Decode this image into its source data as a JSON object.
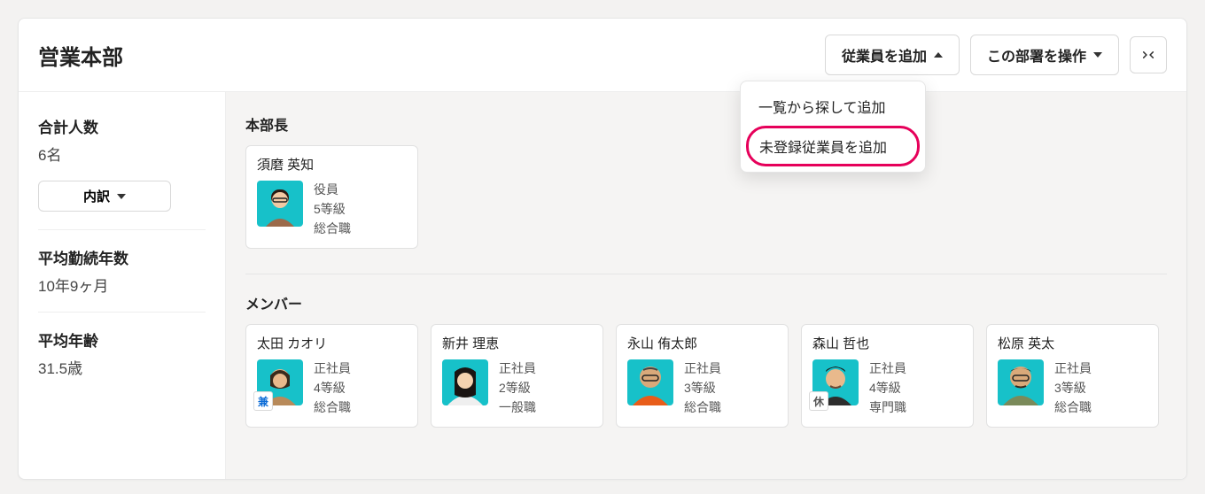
{
  "header": {
    "title": "営業本部",
    "add_employee_label": "従業員を追加",
    "operate_dept_label": "この部署を操作"
  },
  "dropdown": {
    "items": [
      {
        "label": "一覧から探して追加"
      },
      {
        "label": "未登録従業員を追加"
      }
    ]
  },
  "sidebar": {
    "total_label": "合計人数",
    "total_value": "6名",
    "breakdown_label": "内訳",
    "tenure_label": "平均勤続年数",
    "tenure_value": "10年9ヶ月",
    "age_label": "平均年齢",
    "age_value": "31.5歳"
  },
  "sections": {
    "head": {
      "title": "本部長",
      "members": [
        {
          "name": "須磨 英知",
          "type": "役員",
          "grade": "5等級",
          "track": "総合職",
          "badge": ""
        }
      ]
    },
    "members": {
      "title": "メンバー",
      "members": [
        {
          "name": "太田 カオリ",
          "type": "正社員",
          "grade": "4等級",
          "track": "総合職",
          "badge": "兼"
        },
        {
          "name": "新井 理恵",
          "type": "正社員",
          "grade": "2等級",
          "track": "一般職",
          "badge": ""
        },
        {
          "name": "永山 侑太郎",
          "type": "正社員",
          "grade": "3等級",
          "track": "総合職",
          "badge": ""
        },
        {
          "name": "森山 哲也",
          "type": "正社員",
          "grade": "4等級",
          "track": "専門職",
          "badge": "休"
        },
        {
          "name": "松原 英太",
          "type": "正社員",
          "grade": "3等級",
          "track": "総合職",
          "badge": ""
        }
      ]
    }
  }
}
